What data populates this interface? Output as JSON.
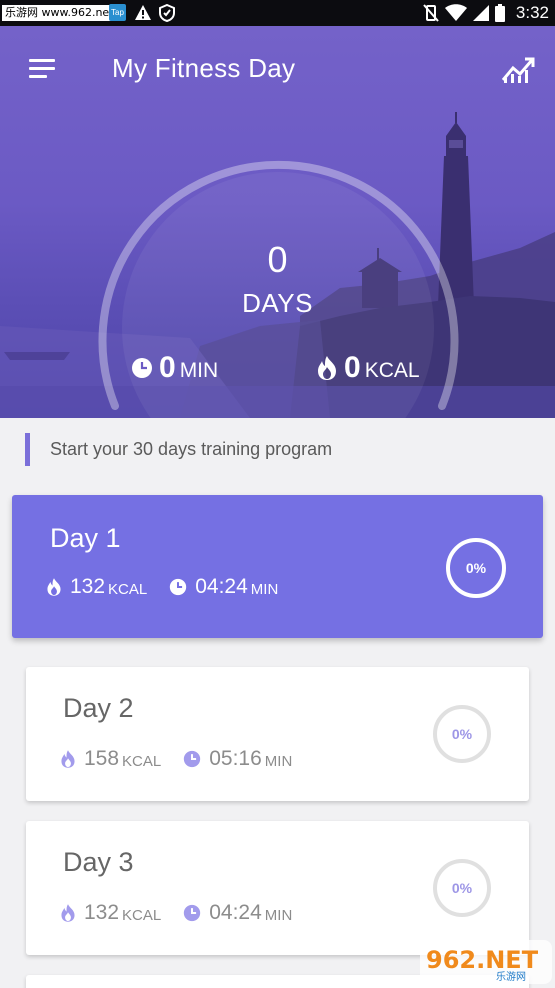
{
  "status_bar": {
    "site_badge": "乐游网 www.962.net",
    "app_badge": "Tap",
    "time": "3:32"
  },
  "header": {
    "title": "My Fitness Day"
  },
  "summary": {
    "days_value": "0",
    "days_label": "DAYS",
    "minutes_value": "0",
    "minutes_unit": "MIN",
    "kcal_value": "0",
    "kcal_unit": "KCAL"
  },
  "program_label": "Start your 30 days training program",
  "days": [
    {
      "title": "Day 1",
      "kcal": "132",
      "kcal_unit": "KCAL",
      "time": "04:24",
      "time_unit": "MIN",
      "progress": "0%"
    },
    {
      "title": "Day 2",
      "kcal": "158",
      "kcal_unit": "KCAL",
      "time": "05:16",
      "time_unit": "MIN",
      "progress": "0%"
    },
    {
      "title": "Day 3",
      "kcal": "132",
      "kcal_unit": "KCAL",
      "time": "04:24",
      "time_unit": "MIN",
      "progress": "0%"
    }
  ],
  "watermark": {
    "text": "962.NET",
    "subtext": "乐游网"
  },
  "colors": {
    "accent": "#7570e3",
    "header": "#6b5ac4",
    "inactive_ring": "#e0e0e0"
  }
}
